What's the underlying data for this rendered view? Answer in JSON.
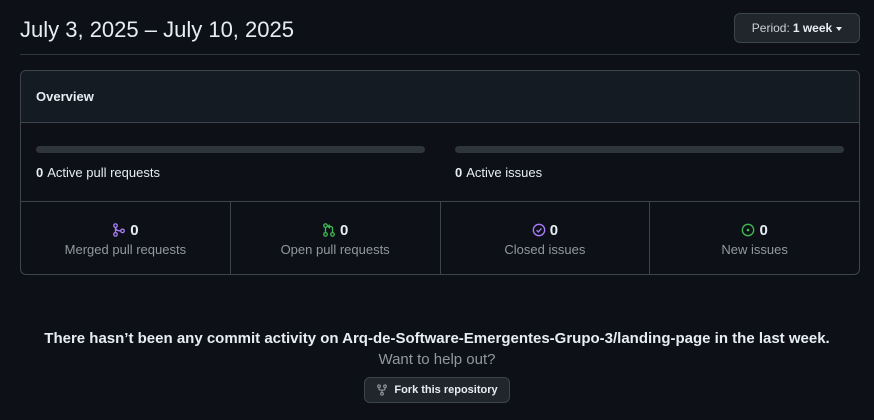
{
  "header": {
    "date_range": "July 3, 2025 – July 10, 2025",
    "period_label": "Period:",
    "period_value": "1 week"
  },
  "overview": {
    "title": "Overview",
    "active_prs": {
      "count": "0",
      "label": "Active pull requests"
    },
    "active_issues": {
      "count": "0",
      "label": "Active issues"
    },
    "stats": [
      {
        "icon": "git-merge-icon",
        "count": "0",
        "label": "Merged pull requests",
        "color": "#ab7df8"
      },
      {
        "icon": "git-pull-request-icon",
        "count": "0",
        "label": "Open pull requests",
        "color": "#3fb950"
      },
      {
        "icon": "issue-closed-icon",
        "count": "0",
        "label": "Closed issues",
        "color": "#ab7df8"
      },
      {
        "icon": "issue-opened-icon",
        "count": "0",
        "label": "New issues",
        "color": "#3fb950"
      }
    ]
  },
  "commit_activity": {
    "message": "There hasn’t been any commit activity on Arq-de-Software-Emergentes-Grupo-3/landing-page in the last week.",
    "subtext": "Want to help out?",
    "fork_button": "Fork this repository"
  }
}
